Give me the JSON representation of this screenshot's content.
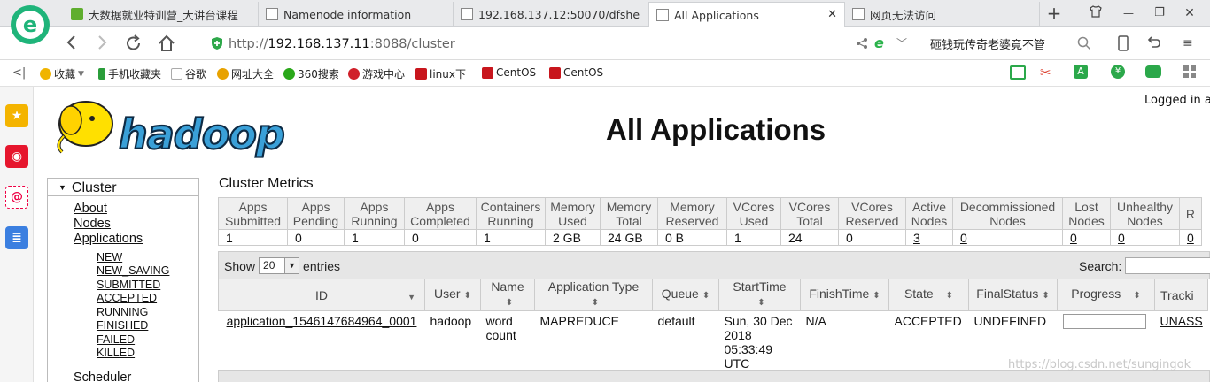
{
  "tabs": [
    {
      "label": "大数据就业特训营_大讲台课程",
      "active": false
    },
    {
      "label": "Namenode information",
      "active": false
    },
    {
      "label": "192.168.137.12:50070/dfshe",
      "active": false
    },
    {
      "label": "All Applications",
      "active": true
    },
    {
      "label": "网页无法访问",
      "active": false
    }
  ],
  "window": {
    "new_tab": "+",
    "minimize": "—",
    "maximize": "❐",
    "close": "✕"
  },
  "address": {
    "scheme": "http://",
    "host": "192.168.137.11",
    "rest": ":8088/cluster"
  },
  "search_text": "砸钱玩传奇老婆竟不管",
  "bookmarks": [
    {
      "label": "收藏",
      "icon": "star-icon",
      "color": "#f0b400"
    },
    {
      "label": "手机收藏夹",
      "icon": "phone-icon",
      "color": "#2a9d3a"
    },
    {
      "label": "谷歌",
      "icon": "page-icon",
      "color": "#aaaaaa"
    },
    {
      "label": "网址大全",
      "icon": "browser-icon",
      "color": "#e8a200"
    },
    {
      "label": "360搜索",
      "icon": "search-360-icon",
      "color": "#2aa81a"
    },
    {
      "label": "游戏中心",
      "icon": "game-icon",
      "color": "#d0202a"
    },
    {
      "label": "linux下",
      "icon": "csdn-icon",
      "color": "#c8161d"
    },
    {
      "label": "CentOS",
      "icon": "csdn-icon",
      "color": "#c8161d"
    },
    {
      "label": "CentOS",
      "icon": "csdn-icon",
      "color": "#c8161d"
    }
  ],
  "page": {
    "logged_in": "Logged in a",
    "title": "All Applications",
    "logo_text": "hadoop"
  },
  "nav": {
    "cluster": "Cluster",
    "links": [
      "About",
      "Nodes",
      "Applications"
    ],
    "states": [
      "NEW",
      "NEW_SAVING",
      "SUBMITTED",
      "ACCEPTED",
      "RUNNING",
      "FINISHED",
      "FAILED",
      "KILLED"
    ],
    "scheduler": "Scheduler"
  },
  "cluster_metrics": {
    "title": "Cluster Metrics",
    "headers": [
      [
        "Apps",
        "Submitted"
      ],
      [
        "Apps",
        "Pending"
      ],
      [
        "Apps",
        "Running"
      ],
      [
        "Apps",
        "Completed"
      ],
      [
        "Containers",
        "Running"
      ],
      [
        "Memory",
        "Used"
      ],
      [
        "Memory",
        "Total"
      ],
      [
        "Memory",
        "Reserved"
      ],
      [
        "VCores",
        "Used"
      ],
      [
        "VCores",
        "Total"
      ],
      [
        "VCores",
        "Reserved"
      ],
      [
        "Active",
        "Nodes"
      ],
      [
        "Decommissioned",
        "Nodes"
      ],
      [
        "Lost",
        "Nodes"
      ],
      [
        "Unhealthy",
        "Nodes"
      ],
      [
        "R",
        ""
      ]
    ],
    "values": [
      "1",
      "0",
      "1",
      "0",
      "1",
      "2 GB",
      "24 GB",
      "0 B",
      "1",
      "24",
      "0",
      "3",
      "0",
      "0",
      "0",
      "0"
    ]
  },
  "table_controls": {
    "show": "Show",
    "entries_value": "20",
    "entries": "entries",
    "search": "Search:"
  },
  "apps_table": {
    "headers": [
      "ID",
      "User",
      "Name",
      "Application Type",
      "Queue",
      "StartTime",
      "FinishTime",
      "State",
      "FinalStatus",
      "Progress",
      "Tracki"
    ],
    "row": {
      "id": "application_1546147684964_0001",
      "user": "hadoop",
      "name": "word count",
      "type": "MAPREDUCE",
      "queue": "default",
      "start": "Sun, 30 Dec 2018 05:33:49 UTC",
      "finish": "N/A",
      "state": "ACCEPTED",
      "final": "UNDEFINED",
      "progress": 0,
      "tracking": "UNASS"
    }
  },
  "watermark": "https://blog.csdn.net/sungingok"
}
